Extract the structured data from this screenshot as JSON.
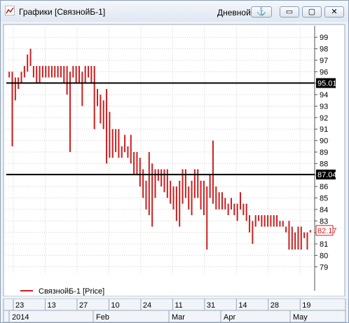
{
  "window": {
    "title": "Графики [СвязнойБ-1]",
    "period": "Дневной",
    "anchor_glyph": "⚓",
    "minimize_glyph": "▭",
    "maximize_glyph": "▢",
    "close_glyph": "✕"
  },
  "legend": {
    "label": "СвязнойБ-1 [Price]"
  },
  "y_ticks": [
    "99",
    "98",
    "97",
    "96",
    "95",
    "94",
    "93",
    "92",
    "91",
    "90",
    "89",
    "88",
    "87",
    "86",
    "85",
    "84",
    "83",
    "82",
    "81",
    "80",
    "79"
  ],
  "price_labels": {
    "upper": "95.01",
    "lower": "87.04",
    "last": "82.17"
  },
  "x_day_ticks": [
    "23",
    "13",
    "27",
    "10",
    "24",
    "11",
    "31",
    "14",
    "28",
    "19"
  ],
  "x_month_ticks": [
    "2014",
    "Feb",
    "Mar",
    "Apr",
    "May"
  ],
  "colors": {
    "series": "#cc1f1f",
    "horizontal_line": "#000000",
    "grid": "#cfcfcf"
  },
  "chart_data": {
    "type": "bar",
    "series": [
      {
        "name": "СвязнойБ-1 [Price]",
        "ranges": [
          [
            95.5,
            96.0
          ],
          [
            89.5,
            96.0
          ],
          [
            93.5,
            95.5
          ],
          [
            94.5,
            95.5
          ],
          [
            95.0,
            96.0
          ],
          [
            95.5,
            96.5
          ],
          [
            96.0,
            97.5
          ],
          [
            96.5,
            98.0
          ],
          [
            95.5,
            96.5
          ],
          [
            95.0,
            96.5
          ],
          [
            95.0,
            96.5
          ],
          [
            95.5,
            96.5
          ],
          [
            95.5,
            96.5
          ],
          [
            95.5,
            96.5
          ],
          [
            95.5,
            96.5
          ],
          [
            95.5,
            96.5
          ],
          [
            95.5,
            96.5
          ],
          [
            95.5,
            96.5
          ],
          [
            95.0,
            96.5
          ],
          [
            94.0,
            96.5
          ],
          [
            89.0,
            96.0
          ],
          [
            95.5,
            96.5
          ],
          [
            95.0,
            96.5
          ],
          [
            95.0,
            96.5
          ],
          [
            93.0,
            96.0
          ],
          [
            95.0,
            96.5
          ],
          [
            95.5,
            96.5
          ],
          [
            95.0,
            96.5
          ],
          [
            91.0,
            96.5
          ],
          [
            93.0,
            94.5
          ],
          [
            91.5,
            94.0
          ],
          [
            91.0,
            93.5
          ],
          [
            88.0,
            94.5
          ],
          [
            88.5,
            92.5
          ],
          [
            88.5,
            91.0
          ],
          [
            89.0,
            91.0
          ],
          [
            88.5,
            91.0
          ],
          [
            88.5,
            89.5
          ],
          [
            89.0,
            90.5
          ],
          [
            88.5,
            89.5
          ],
          [
            88.0,
            90.5
          ],
          [
            87.0,
            89.0
          ],
          [
            87.0,
            89.0
          ],
          [
            86.0,
            88.5
          ],
          [
            85.0,
            87.5
          ],
          [
            84.0,
            86.5
          ],
          [
            83.5,
            89.0
          ],
          [
            82.5,
            88.0
          ],
          [
            85.0,
            87.5
          ],
          [
            86.5,
            87.5
          ],
          [
            86.0,
            87.5
          ],
          [
            85.5,
            87.5
          ],
          [
            85.0,
            87.5
          ],
          [
            84.5,
            86.5
          ],
          [
            84.0,
            86.0
          ],
          [
            83.0,
            86.0
          ],
          [
            82.5,
            86.5
          ],
          [
            84.5,
            87.5
          ],
          [
            85.0,
            87.5
          ],
          [
            84.0,
            86.0
          ],
          [
            83.5,
            86.5
          ],
          [
            85.0,
            87.5
          ],
          [
            85.0,
            87.5
          ],
          [
            84.0,
            86.5
          ],
          [
            83.5,
            86.5
          ],
          [
            80.5,
            86.0
          ],
          [
            85.0,
            87.0
          ],
          [
            84.5,
            90.0
          ],
          [
            84.0,
            86.0
          ],
          [
            84.0,
            85.5
          ],
          [
            84.0,
            85.5
          ],
          [
            84.0,
            85.0
          ],
          [
            83.5,
            84.5
          ],
          [
            84.0,
            85.0
          ],
          [
            83.5,
            84.5
          ],
          [
            83.0,
            84.5
          ],
          [
            84.0,
            85.5
          ],
          [
            83.5,
            84.5
          ],
          [
            83.0,
            84.5
          ],
          [
            82.0,
            83.5
          ],
          [
            81.0,
            83.0
          ],
          [
            82.5,
            83.5
          ],
          [
            83.0,
            83.5
          ],
          [
            82.5,
            83.5
          ],
          [
            82.5,
            83.5
          ],
          [
            82.5,
            83.5
          ],
          [
            82.5,
            83.5
          ],
          [
            82.5,
            83.5
          ],
          [
            82.5,
            83.5
          ],
          [
            82.5,
            83.0
          ],
          [
            82.5,
            83.0
          ],
          [
            82.0,
            82.5
          ],
          [
            80.5,
            83.0
          ],
          [
            80.5,
            82.5
          ],
          [
            80.5,
            82.0
          ],
          [
            80.5,
            82.5
          ],
          [
            80.5,
            82.5
          ],
          [
            81.5,
            82.0
          ],
          [
            80.5,
            82.0
          ],
          [
            82.0,
            82.2
          ]
        ]
      }
    ],
    "horizontal_lines": [
      95.01,
      87.04
    ],
    "last_value": 82.17,
    "ylim": [
      78.5,
      99.5
    ],
    "grid": true,
    "legend_position": "bottom-left"
  }
}
